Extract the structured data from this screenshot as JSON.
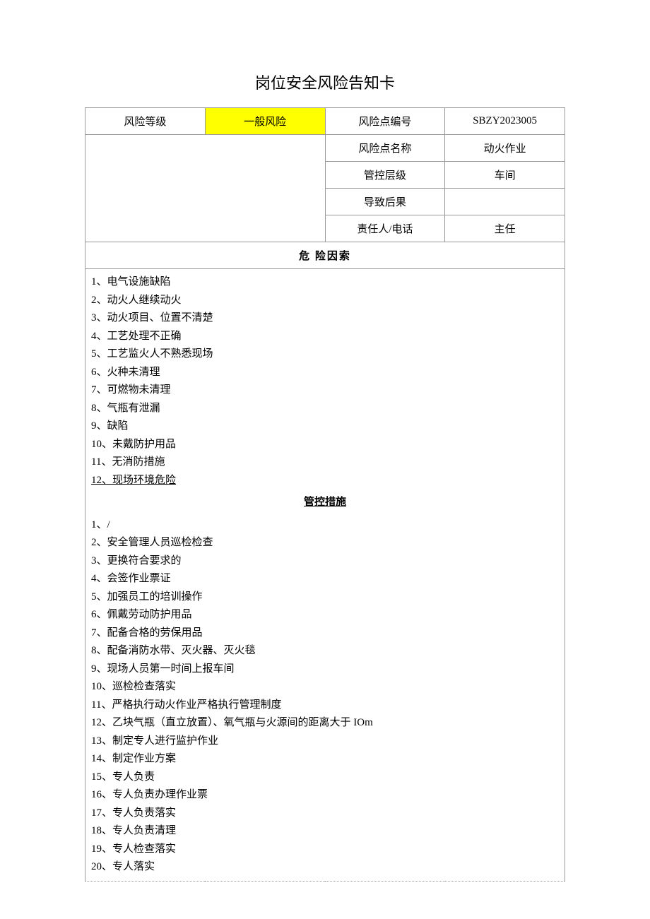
{
  "title": "岗位安全风险告知卡",
  "header": {
    "risk_level_label": "风险等级",
    "risk_level_value": "一般风险",
    "risk_id_label": "风险点编号",
    "risk_id_value": "SBZY2023005",
    "risk_name_label": "风险点名称",
    "risk_name_value": "动火作业",
    "control_level_label": "管控层级",
    "control_level_value": "车间",
    "consequence_label": "导致后果",
    "consequence_value": "",
    "responsible_label": "责任人/电话",
    "responsible_value": "主任"
  },
  "factors": {
    "heading": "危 险因索",
    "items": [
      "1、电气设施缺陷",
      "2、动火人继续动火",
      "3、动火项目、位置不清楚",
      "4、工艺处理不正确",
      "5、工艺监火人不熟悉现场",
      "6、火种未清理",
      "7、可燃物未清理",
      "8、气瓶有泄漏",
      "9、缺陷",
      "10、未戴防护用品",
      "11、无消防措施",
      "12、现场环境危险"
    ]
  },
  "measures": {
    "heading": "管控措施",
    "items": [
      "1、/",
      "2、安全管理人员巡检检查",
      "3、更换符合要求的",
      "4、会签作业票证",
      "5、加强员工的培训操作",
      "6、佩戴劳动防护用品",
      "7、配备合格的劳保用品",
      "8、配备消防水带、灭火器、灭火毯",
      "9、现场人员第一时间上报车间",
      "10、巡检检查落实",
      "11、严格执行动火作业严格执行管理制度",
      "12、乙块气瓶（直立放置）、氧气瓶与火源间的距离大于 IOm",
      "13、制定专人进行监护作业",
      "14、制定作业方案",
      "15、专人负责",
      "16、专人负责办理作业票",
      "17、专人负责落实",
      "18、专人负责清理",
      "19、专人检查落实",
      "20、专人落实"
    ]
  }
}
